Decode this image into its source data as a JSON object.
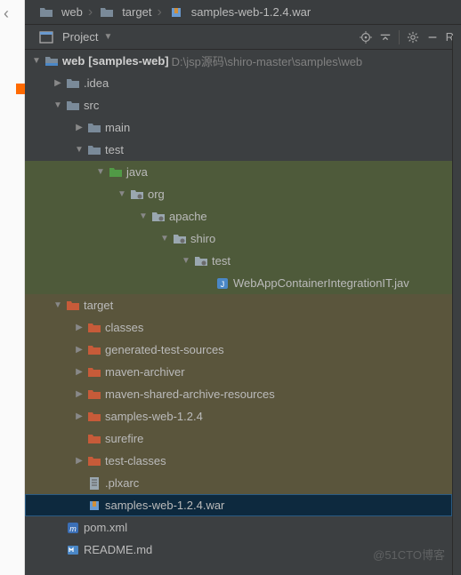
{
  "breadcrumb": {
    "item1": "web",
    "item2": "target",
    "item3": "samples-web-1.2.4.war"
  },
  "toolbar": {
    "project_label": "Project",
    "right_letter": "R"
  },
  "watermark": "@51CTO博客",
  "tree": {
    "root": {
      "name": "web",
      "bracket": "[samples-web]",
      "path": "D:\\jsp源码\\shiro-master\\samples\\web"
    },
    "idea": ".idea",
    "src": "src",
    "main": "main",
    "test": "test",
    "java": "java",
    "org": "org",
    "apache": "apache",
    "shiro": "shiro",
    "test2": "test",
    "testfile": "WebAppContainerIntegrationIT.jav",
    "target": "target",
    "classes": "classes",
    "gensrc": "generated-test-sources",
    "mvnarch": "maven-archiver",
    "mvnshared": "maven-shared-archive-resources",
    "sw124": "samples-web-1.2.4",
    "surefire": "surefire",
    "testclasses": "test-classes",
    "plxarc": ".plxarc",
    "war": "samples-web-1.2.4.war",
    "pom": "pom.xml",
    "readme": "README.md"
  }
}
